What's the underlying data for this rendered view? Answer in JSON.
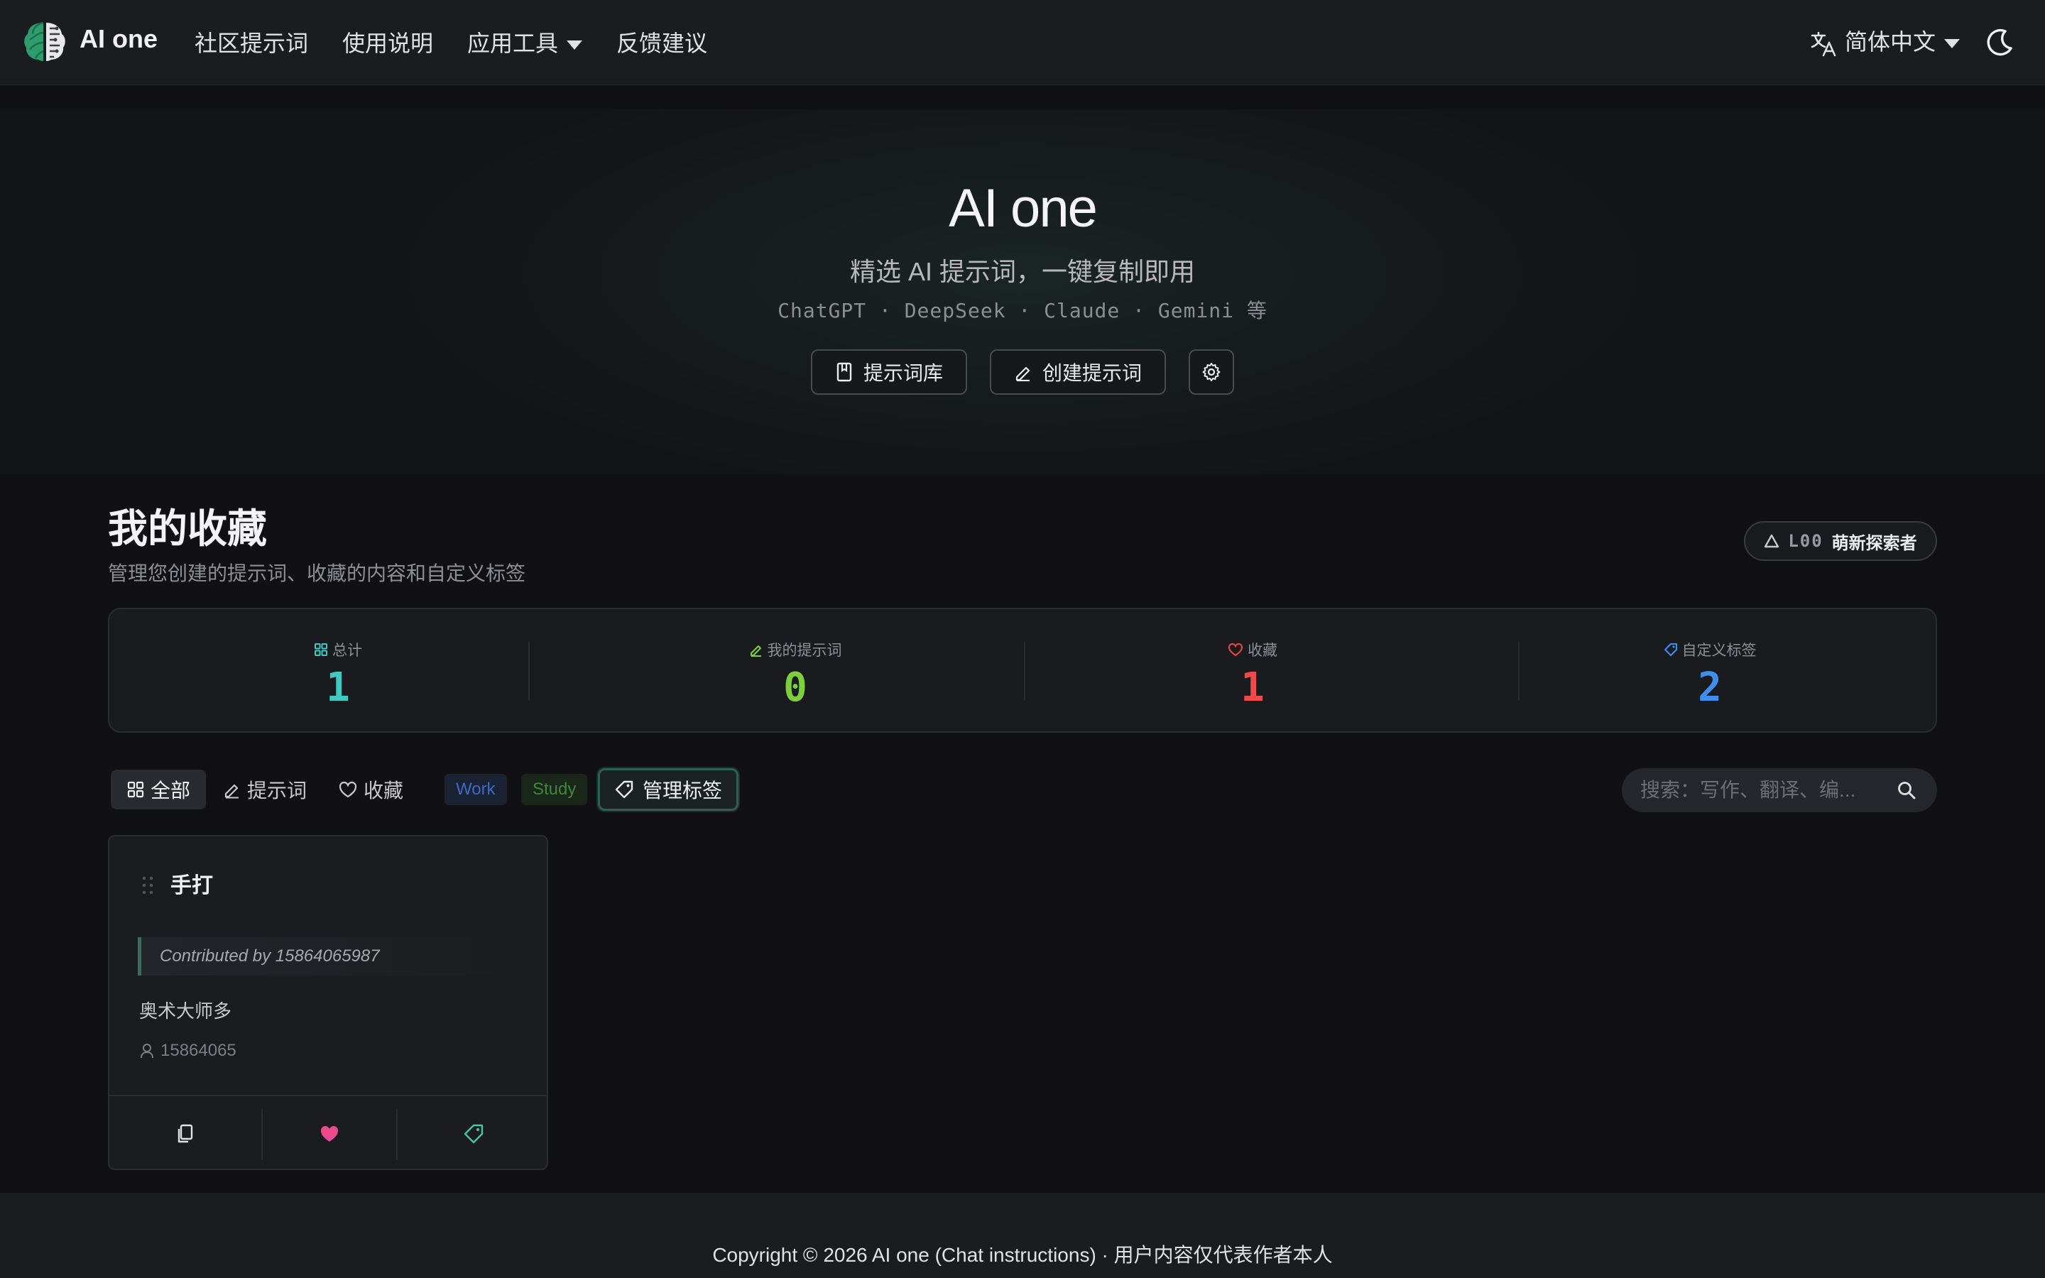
{
  "nav": {
    "brand": "AI one",
    "links": [
      "社区提示词",
      "使用说明",
      "应用工具",
      "反馈建议"
    ],
    "language": "简体中文"
  },
  "hero": {
    "title": "AI one",
    "subtitle": "精选 AI 提示词，一键复制即用",
    "models": "ChatGPT · DeepSeek · Claude · Gemini 等",
    "btn_library": "提示词库",
    "btn_create": "创建提示词"
  },
  "section": {
    "title": "我的收藏",
    "subtitle": "管理您创建的提示词、收藏的内容和自定义标签",
    "level_code": "L00",
    "level_name": "萌新探索者"
  },
  "stats": [
    {
      "label": "总计",
      "value": "1",
      "color": "#3fc9c1"
    },
    {
      "label": "我的提示词",
      "value": "0",
      "color": "#7ed03a"
    },
    {
      "label": "收藏",
      "value": "1",
      "color": "#ee4a4a"
    },
    {
      "label": "自定义标签",
      "value": "2",
      "color": "#3d8ef0"
    }
  ],
  "filters": {
    "all": "全部",
    "prompts": "提示词",
    "favorites": "收藏",
    "tags": [
      "Work",
      "Study"
    ],
    "manage_tags": "管理标签",
    "search_placeholder": "搜索：写作、翻译、编..."
  },
  "card": {
    "title": "手打",
    "quote": "Contributed by 15864065987",
    "body": "奥术大师多",
    "author": "15864065"
  },
  "footer": {
    "text": "Copyright © 2026 AI one (Chat instructions) · 用户内容仅代表作者本人"
  }
}
